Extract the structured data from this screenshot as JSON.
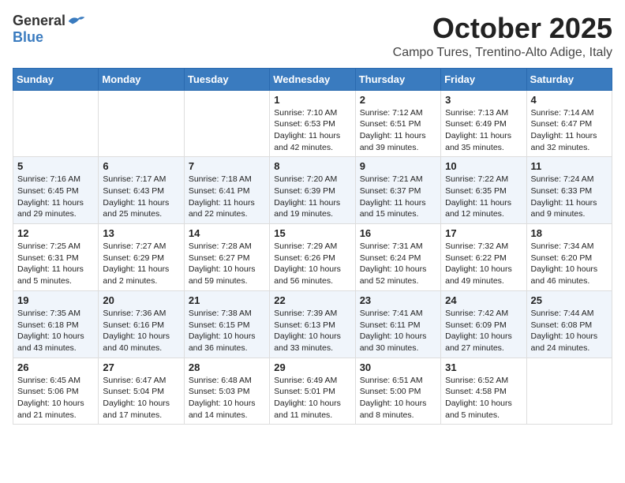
{
  "header": {
    "logo_general": "General",
    "logo_blue": "Blue",
    "month_title": "October 2025",
    "location": "Campo Tures, Trentino-Alto Adige, Italy"
  },
  "days_of_week": [
    "Sunday",
    "Monday",
    "Tuesday",
    "Wednesday",
    "Thursday",
    "Friday",
    "Saturday"
  ],
  "weeks": [
    [
      {
        "day": "",
        "content": ""
      },
      {
        "day": "",
        "content": ""
      },
      {
        "day": "",
        "content": ""
      },
      {
        "day": "1",
        "content": "Sunrise: 7:10 AM\nSunset: 6:53 PM\nDaylight: 11 hours and 42 minutes."
      },
      {
        "day": "2",
        "content": "Sunrise: 7:12 AM\nSunset: 6:51 PM\nDaylight: 11 hours and 39 minutes."
      },
      {
        "day": "3",
        "content": "Sunrise: 7:13 AM\nSunset: 6:49 PM\nDaylight: 11 hours and 35 minutes."
      },
      {
        "day": "4",
        "content": "Sunrise: 7:14 AM\nSunset: 6:47 PM\nDaylight: 11 hours and 32 minutes."
      }
    ],
    [
      {
        "day": "5",
        "content": "Sunrise: 7:16 AM\nSunset: 6:45 PM\nDaylight: 11 hours and 29 minutes."
      },
      {
        "day": "6",
        "content": "Sunrise: 7:17 AM\nSunset: 6:43 PM\nDaylight: 11 hours and 25 minutes."
      },
      {
        "day": "7",
        "content": "Sunrise: 7:18 AM\nSunset: 6:41 PM\nDaylight: 11 hours and 22 minutes."
      },
      {
        "day": "8",
        "content": "Sunrise: 7:20 AM\nSunset: 6:39 PM\nDaylight: 11 hours and 19 minutes."
      },
      {
        "day": "9",
        "content": "Sunrise: 7:21 AM\nSunset: 6:37 PM\nDaylight: 11 hours and 15 minutes."
      },
      {
        "day": "10",
        "content": "Sunrise: 7:22 AM\nSunset: 6:35 PM\nDaylight: 11 hours and 12 minutes."
      },
      {
        "day": "11",
        "content": "Sunrise: 7:24 AM\nSunset: 6:33 PM\nDaylight: 11 hours and 9 minutes."
      }
    ],
    [
      {
        "day": "12",
        "content": "Sunrise: 7:25 AM\nSunset: 6:31 PM\nDaylight: 11 hours and 5 minutes."
      },
      {
        "day": "13",
        "content": "Sunrise: 7:27 AM\nSunset: 6:29 PM\nDaylight: 11 hours and 2 minutes."
      },
      {
        "day": "14",
        "content": "Sunrise: 7:28 AM\nSunset: 6:27 PM\nDaylight: 10 hours and 59 minutes."
      },
      {
        "day": "15",
        "content": "Sunrise: 7:29 AM\nSunset: 6:26 PM\nDaylight: 10 hours and 56 minutes."
      },
      {
        "day": "16",
        "content": "Sunrise: 7:31 AM\nSunset: 6:24 PM\nDaylight: 10 hours and 52 minutes."
      },
      {
        "day": "17",
        "content": "Sunrise: 7:32 AM\nSunset: 6:22 PM\nDaylight: 10 hours and 49 minutes."
      },
      {
        "day": "18",
        "content": "Sunrise: 7:34 AM\nSunset: 6:20 PM\nDaylight: 10 hours and 46 minutes."
      }
    ],
    [
      {
        "day": "19",
        "content": "Sunrise: 7:35 AM\nSunset: 6:18 PM\nDaylight: 10 hours and 43 minutes."
      },
      {
        "day": "20",
        "content": "Sunrise: 7:36 AM\nSunset: 6:16 PM\nDaylight: 10 hours and 40 minutes."
      },
      {
        "day": "21",
        "content": "Sunrise: 7:38 AM\nSunset: 6:15 PM\nDaylight: 10 hours and 36 minutes."
      },
      {
        "day": "22",
        "content": "Sunrise: 7:39 AM\nSunset: 6:13 PM\nDaylight: 10 hours and 33 minutes."
      },
      {
        "day": "23",
        "content": "Sunrise: 7:41 AM\nSunset: 6:11 PM\nDaylight: 10 hours and 30 minutes."
      },
      {
        "day": "24",
        "content": "Sunrise: 7:42 AM\nSunset: 6:09 PM\nDaylight: 10 hours and 27 minutes."
      },
      {
        "day": "25",
        "content": "Sunrise: 7:44 AM\nSunset: 6:08 PM\nDaylight: 10 hours and 24 minutes."
      }
    ],
    [
      {
        "day": "26",
        "content": "Sunrise: 6:45 AM\nSunset: 5:06 PM\nDaylight: 10 hours and 21 minutes."
      },
      {
        "day": "27",
        "content": "Sunrise: 6:47 AM\nSunset: 5:04 PM\nDaylight: 10 hours and 17 minutes."
      },
      {
        "day": "28",
        "content": "Sunrise: 6:48 AM\nSunset: 5:03 PM\nDaylight: 10 hours and 14 minutes."
      },
      {
        "day": "29",
        "content": "Sunrise: 6:49 AM\nSunset: 5:01 PM\nDaylight: 10 hours and 11 minutes."
      },
      {
        "day": "30",
        "content": "Sunrise: 6:51 AM\nSunset: 5:00 PM\nDaylight: 10 hours and 8 minutes."
      },
      {
        "day": "31",
        "content": "Sunrise: 6:52 AM\nSunset: 4:58 PM\nDaylight: 10 hours and 5 minutes."
      },
      {
        "day": "",
        "content": ""
      }
    ]
  ]
}
